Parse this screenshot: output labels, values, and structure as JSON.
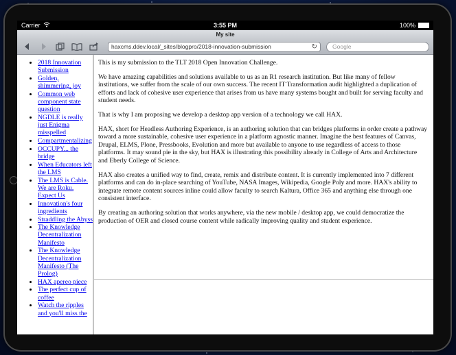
{
  "status": {
    "carrier": "Carrier",
    "time": "3:55 PM",
    "battery": "100%"
  },
  "browser": {
    "title": "My site",
    "url": "haxcms.ddev.local/_sites/blogpro/2018-innovation-submission",
    "search_placeholder": "Google"
  },
  "sidebar": {
    "items": [
      {
        "label": "2018 Innovation Submission"
      },
      {
        "label": "Golden, shimmering, joy"
      },
      {
        "label": "Common web component state question"
      },
      {
        "label": "NGDLE is really just Enigma misspelled"
      },
      {
        "label": "Compartmentalizing"
      },
      {
        "label": "OCCUPY... the bridge"
      },
      {
        "label": "When Educators left the LMS"
      },
      {
        "label": "The LMS is Cable. We are Roku. Expect Us"
      },
      {
        "label": "Innovation's four ingredients"
      },
      {
        "label": "Straddling the Abyss"
      },
      {
        "label": "The Knowledge Decentralization Manifesto"
      },
      {
        "label": "The Knowledge Decentralization Manifesto (The Prolog)"
      },
      {
        "label": "HAX apereo piece"
      },
      {
        "label": "The perfect cup of coffee"
      },
      {
        "label": "Watch the ripples and you'll miss the"
      }
    ]
  },
  "article": {
    "paragraphs": [
      "This is my submission to the TLT 2018 Open Innovation Challenge.",
      "We have amazing capabilities and solutions available to us as an R1 research institution. But like many of fellow institutions, we suffer from the scale of our own success. The recent IT Transformation audit highlighted a duplication of efforts and lack of cohesive user experience that arises from us have many systems bought and built for serving faculty and student needs.",
      "That is why I am proposing we develop a desktop app version of a technology we call HAX.",
      "HAX, short for Headless Authoring Experience, is an authoring solution that can bridges platforms in order create a pathway toward a more sustainable, cohesive user experience in a platform agnostic manner. Imagine the best features of Canvas, Drupal, ELMS, Plone, Pressbooks, Evolution and more but available to anyone to use regardless of access to those platforms. It may sound pie in the sky, but HAX is illustrating this possibility already in College of Arts and Architecture and Eberly College of Science.",
      "HAX also creates a unified way to find, create, remix and distribute content. It is currently implemented into 7 different platforms and can do in-place searching of YouTube, NASA Images, Wikipedia, Google Poly and more. HAX's ability to integrate remote content sources inline could allow faculty to search Kaltura, Office 365 and anything else through one consistent interface.",
      "By creating an authoring solution that works anywhere, via the new mobile / desktop app, we could democratize the production of OER and closed course content while radically improving quality and student experience."
    ]
  }
}
